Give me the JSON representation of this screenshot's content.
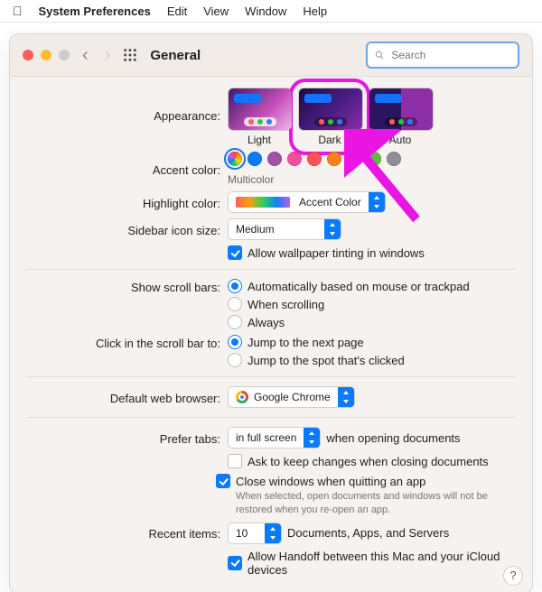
{
  "menubar": {
    "app": "System Preferences",
    "items": [
      "Edit",
      "View",
      "Window",
      "Help"
    ]
  },
  "toolbar": {
    "title": "General",
    "search_placeholder": "Search"
  },
  "appearance": {
    "label": "Appearance:",
    "options": [
      "Light",
      "Dark",
      "Auto"
    ],
    "selected": "Dark"
  },
  "accent": {
    "label": "Accent color:",
    "caption": "Multicolor",
    "colors": [
      "multicolor",
      "#0a7aff",
      "#a550a7",
      "#f74f9e",
      "#ff5257",
      "#f7821b",
      "#ffc600",
      "#62ba46",
      "#8e8e93"
    ],
    "selected_index": 0
  },
  "highlight": {
    "label": "Highlight color:",
    "value": "Accent Color"
  },
  "sidebar_size": {
    "label": "Sidebar icon size:",
    "value": "Medium"
  },
  "wallpaper_tint": {
    "text": "Allow wallpaper tinting in windows",
    "checked": true
  },
  "scrollbars": {
    "label": "Show scroll bars:",
    "options": [
      {
        "text": "Automatically based on mouse or trackpad",
        "checked": true
      },
      {
        "text": "When scrolling",
        "checked": false
      },
      {
        "text": "Always",
        "checked": false
      }
    ]
  },
  "click_scroll": {
    "label": "Click in the scroll bar to:",
    "options": [
      {
        "text": "Jump to the next page",
        "checked": true
      },
      {
        "text": "Jump to the spot that's clicked",
        "checked": false
      }
    ]
  },
  "browser": {
    "label": "Default web browser:",
    "value": "Google Chrome"
  },
  "tabs": {
    "label": "Prefer tabs:",
    "value": "in full screen",
    "suffix": "when opening documents"
  },
  "ask_changes": {
    "text": "Ask to keep changes when closing documents",
    "checked": false
  },
  "close_windows": {
    "text": "Close windows when quitting an app",
    "note": "When selected, open documents and windows will not be restored when you re-open an app.",
    "checked": true
  },
  "recent": {
    "label": "Recent items:",
    "value": "10",
    "suffix": "Documents, Apps, and Servers"
  },
  "handoff": {
    "text": "Allow Handoff between this Mac and your iCloud devices",
    "checked": true
  },
  "help": "?"
}
